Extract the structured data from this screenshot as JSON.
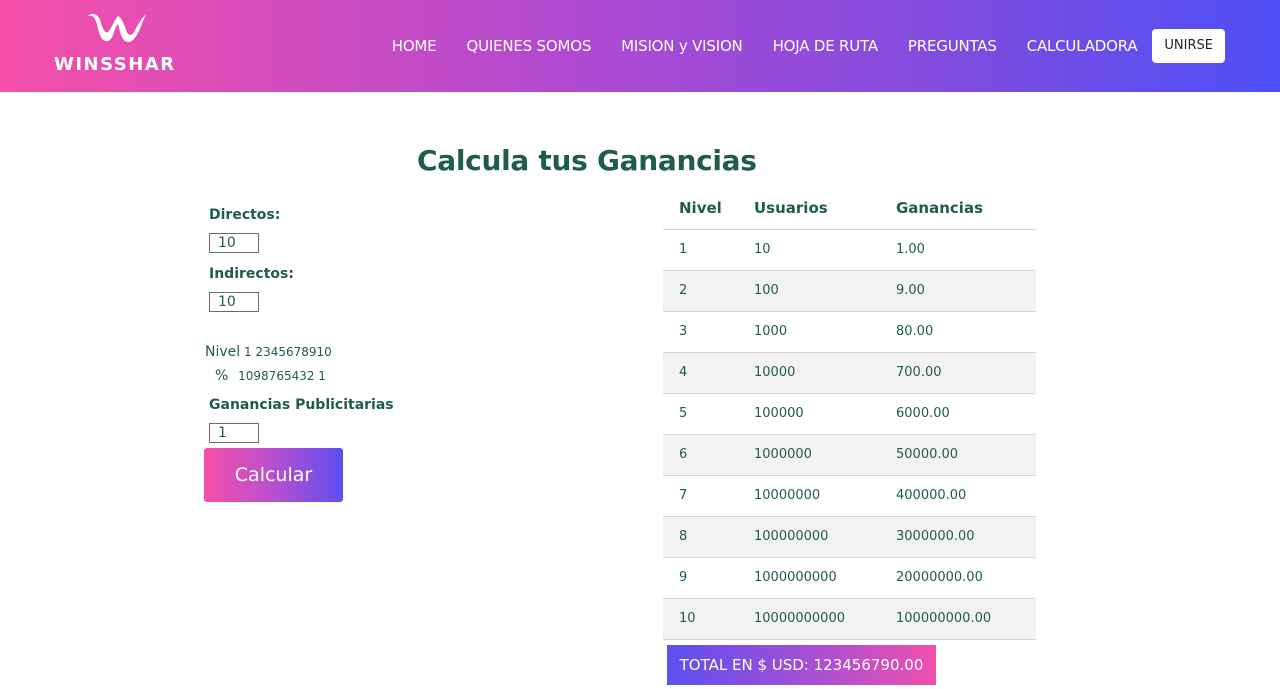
{
  "brand": {
    "name": "WINSSHAR"
  },
  "nav": {
    "items": [
      "HOME",
      "QUIENES SOMOS",
      "MISION y VISION",
      "HOJA DE RUTA",
      "PREGUNTAS",
      "CALCULADORA"
    ],
    "join_label": "UNIRSE"
  },
  "page": {
    "title": "Calcula tus Ganancias"
  },
  "form": {
    "directos_label": "Directos:",
    "directos_value": "10",
    "indirectos_label": "Indirectos:",
    "indirectos_value": "10",
    "nivel_label": "Nivel",
    "nivel_digits": "1 2345678910",
    "percent_symbol": "%",
    "percent_digits": "1098765432 1",
    "publicidad_label": "Ganancias Publicitarias",
    "publicidad_value": "1",
    "calc_label": "Calcular"
  },
  "table": {
    "headers": [
      "Nivel",
      "Usuarios",
      "Ganancias"
    ],
    "rows": [
      [
        "1",
        "10",
        "1.00"
      ],
      [
        "2",
        "100",
        "9.00"
      ],
      [
        "3",
        "1000",
        "80.00"
      ],
      [
        "4",
        "10000",
        "700.00"
      ],
      [
        "5",
        "100000",
        "6000.00"
      ],
      [
        "6",
        "1000000",
        "50000.00"
      ],
      [
        "7",
        "10000000",
        "400000.00"
      ],
      [
        "8",
        "100000000",
        "3000000.00"
      ],
      [
        "9",
        "1000000000",
        "20000000.00"
      ],
      [
        "10",
        "10000000000",
        "100000000.00"
      ]
    ]
  },
  "total": {
    "label": "TOTAL EN $ USD: 123456790.00"
  },
  "colors": {
    "accent_pink": "#f54fa8",
    "accent_blue": "#4d4ff6",
    "text_green": "#1f5c4f"
  }
}
